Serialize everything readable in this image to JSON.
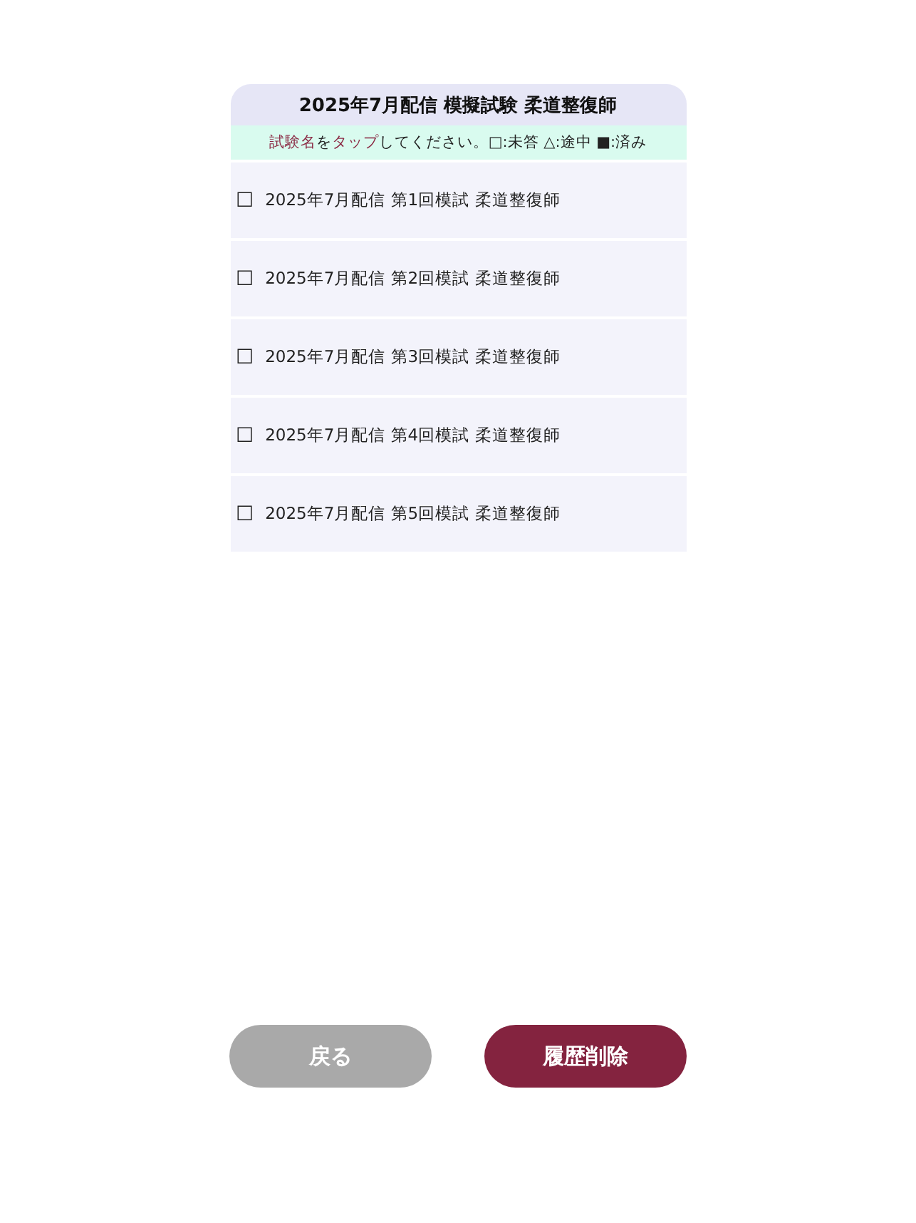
{
  "title": "2025年7月配信 模擬試験 柔道整復師",
  "hint": [
    {
      "text": "試験名",
      "highlight": true
    },
    {
      "text": "を",
      "highlight": false
    },
    {
      "text": "タップ",
      "highlight": true
    },
    {
      "text": "してください。□:未答 △:途中 ■:済み",
      "highlight": false
    }
  ],
  "exams": [
    {
      "mark": "☐",
      "label": "2025年7月配信 第1回模試 柔道整復師"
    },
    {
      "mark": "☐",
      "label": "2025年7月配信 第2回模試 柔道整復師"
    },
    {
      "mark": "☐",
      "label": "2025年7月配信 第3回模試 柔道整復師"
    },
    {
      "mark": "☐",
      "label": "2025年7月配信 第4回模試 柔道整復師"
    },
    {
      "mark": "☐",
      "label": "2025年7月配信 第5回模試 柔道整復師"
    }
  ],
  "buttons": [
    {
      "label": "戻る",
      "disabled": true
    },
    {
      "label": "履歴削除",
      "disabled": false
    }
  ]
}
